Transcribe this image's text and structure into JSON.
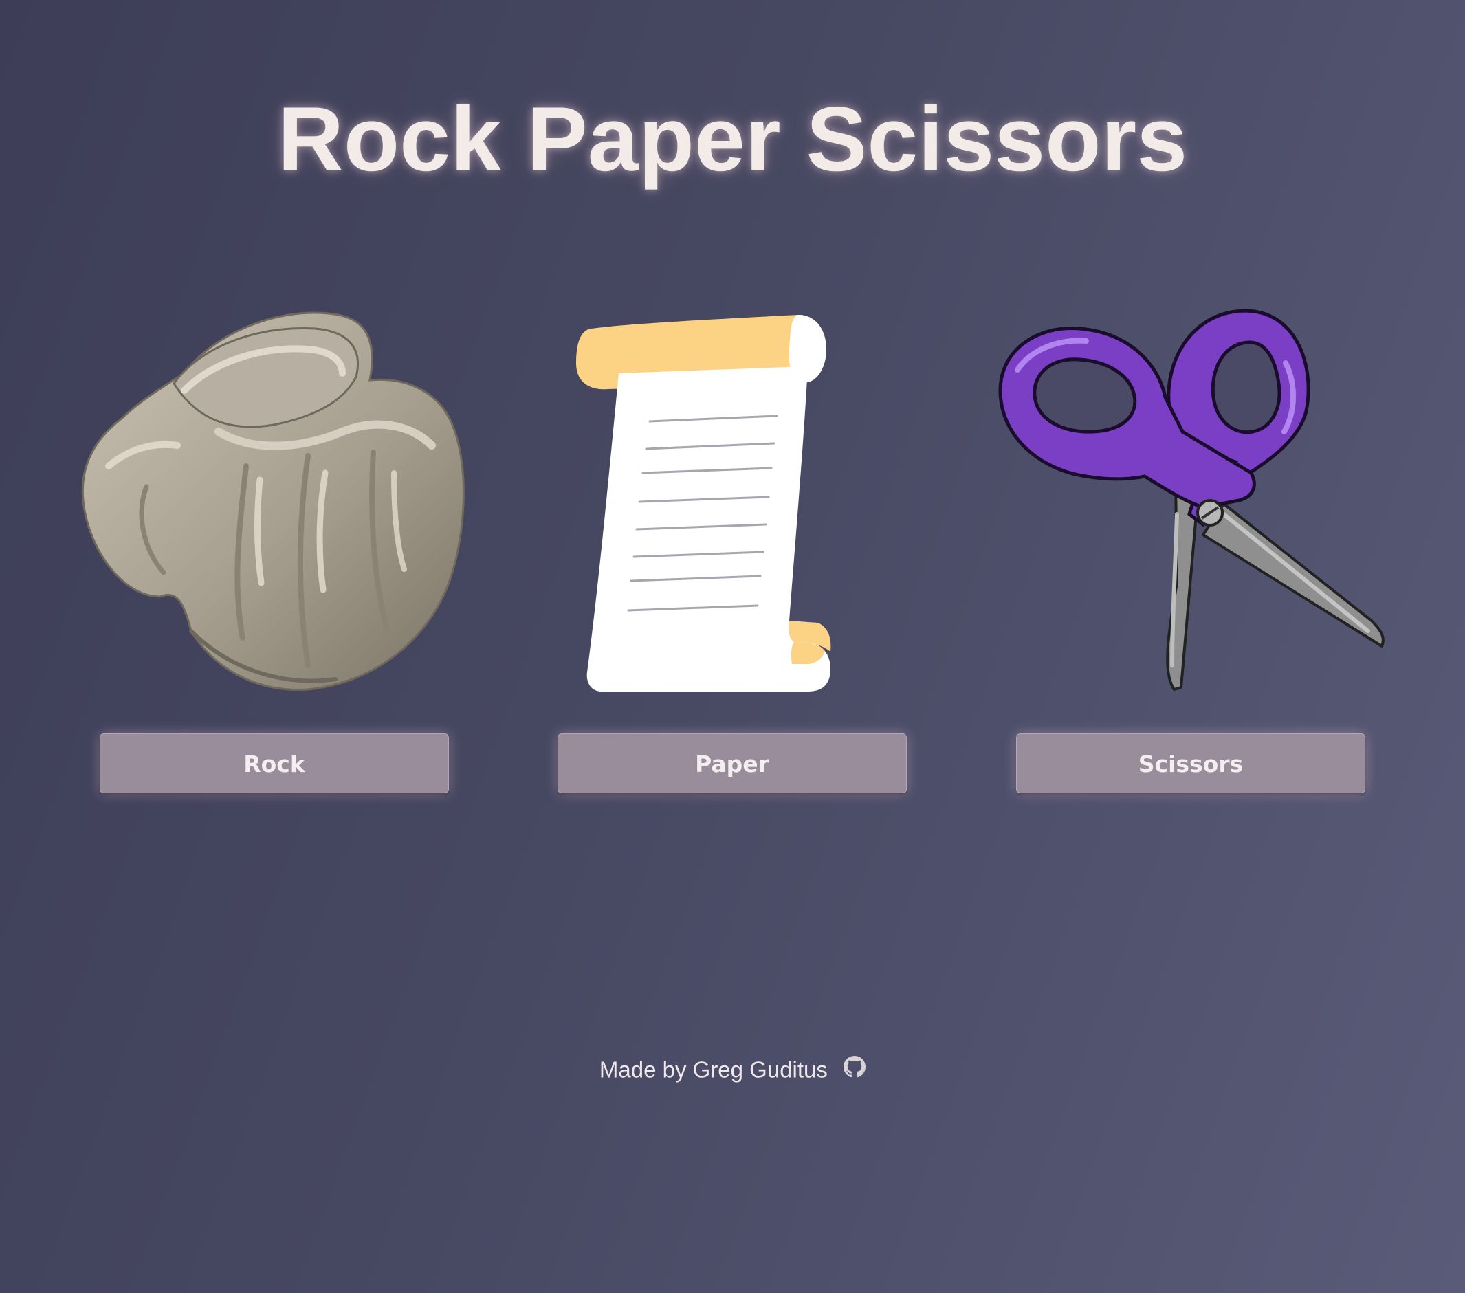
{
  "header": {
    "title": "Rock Paper Scissors"
  },
  "choices": [
    {
      "id": "rock",
      "icon": "rock-icon",
      "label": "Rock"
    },
    {
      "id": "paper",
      "icon": "paper-scroll-icon",
      "label": "Paper"
    },
    {
      "id": "scissors",
      "icon": "scissors-icon",
      "label": "Scissors"
    }
  ],
  "footer": {
    "credit": "Made by Greg Guditus",
    "icon": "github-icon"
  },
  "colors": {
    "background_start": "#3d3d57",
    "background_end": "#5a5b78",
    "title_text": "#f3ebe8",
    "button_bg": "#9a8d9b",
    "button_text": "#f5eef0",
    "scissors_handle": "#7a3fc4"
  }
}
